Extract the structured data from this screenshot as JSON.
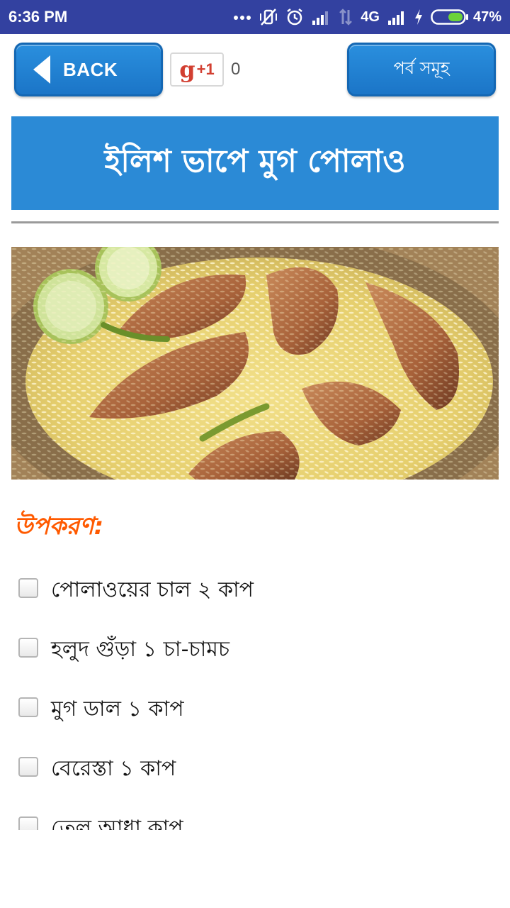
{
  "status_bar": {
    "time": "6:36 PM",
    "network": "4G",
    "battery": "47%"
  },
  "toolbar": {
    "back_label": "BACK",
    "gplus_label": "+1",
    "gplus_count": "0",
    "episodes_label": "পর্ব সমূহ"
  },
  "recipe": {
    "title": "ইলিশ ভাপে মুগ পোলাও"
  },
  "ingredients": {
    "heading": "উপকরণ:",
    "items": [
      "পোলাওয়ের চাল ২ কাপ",
      "হলুদ গুঁড়া ১ চা-চামচ",
      "মুগ ডাল ১ কাপ",
      "বেরেস্তা ১ কাপ",
      "তেল আধা কাপ"
    ]
  },
  "colors": {
    "status_bar": "#3341a0",
    "button_blue": "#1b75c7",
    "banner_blue": "#2b8ad6",
    "heading_orange": "#ff5a00",
    "gplus_red": "#d23f31"
  }
}
